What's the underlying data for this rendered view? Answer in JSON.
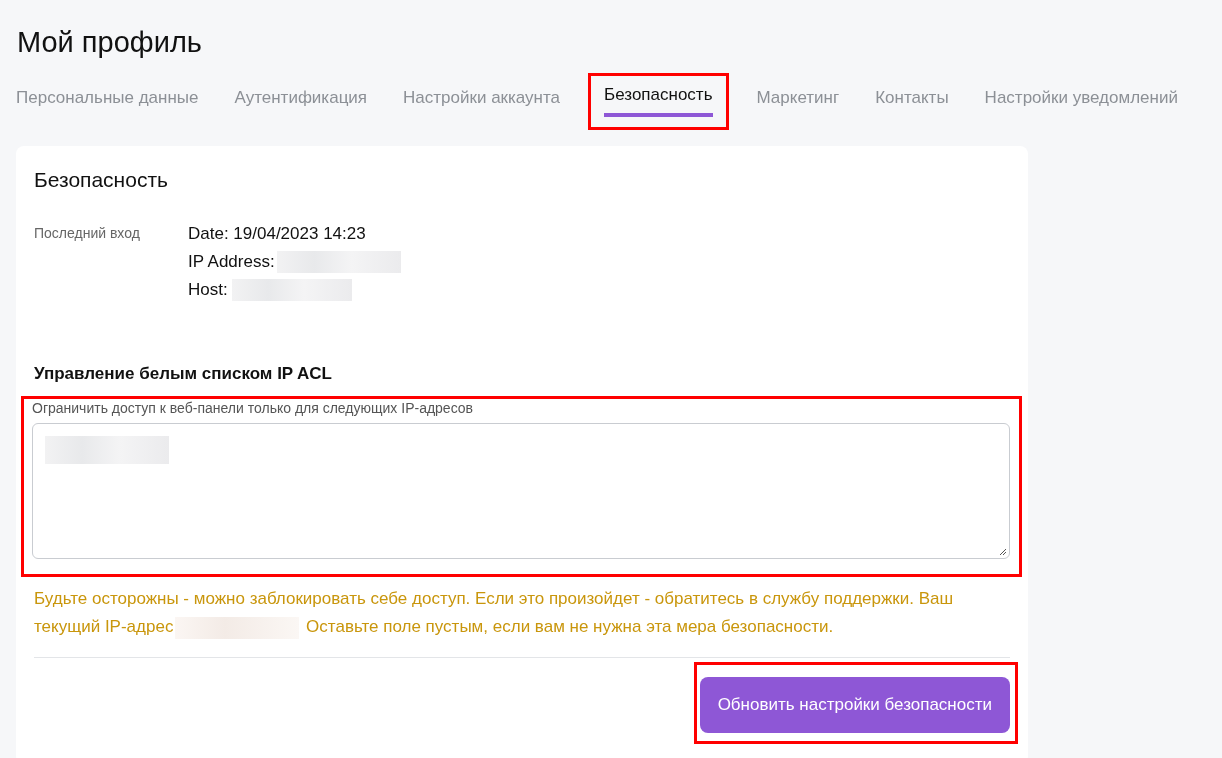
{
  "page": {
    "title": "Мой профиль"
  },
  "tabs": [
    {
      "label": "Персональные данные",
      "selected": false,
      "highlighted": false
    },
    {
      "label": "Аутентификация",
      "selected": false,
      "highlighted": false
    },
    {
      "label": "Настройки аккаунта",
      "selected": false,
      "highlighted": false
    },
    {
      "label": "Безопасность",
      "selected": true,
      "highlighted": true
    },
    {
      "label": "Маркетинг",
      "selected": false,
      "highlighted": false
    },
    {
      "label": "Контакты",
      "selected": false,
      "highlighted": false
    },
    {
      "label": "Настройки уведомлений",
      "selected": false,
      "highlighted": false
    }
  ],
  "card": {
    "title": "Безопасность",
    "last_login": {
      "label": "Последний вход",
      "lines": [
        {
          "text": "Date: 19/04/2023 14:23",
          "redacted": false
        },
        {
          "text": "IP Address:",
          "redacted": true
        },
        {
          "text": "Host:",
          "redacted": true
        }
      ]
    },
    "whitelist": {
      "title": "Управление белым списком IP ACL",
      "field_label": "Ограничить доступ к веб-панели только для следующих IP-адресов",
      "value_redacted": true,
      "highlighted": true
    },
    "warning": {
      "before": "Будьте осторожны - можно заблокировать себе доступ. Если это произойдет - обратитесь в службу поддержки. Ваш текущий IP-адрес",
      "redacted": true,
      "after": "Оставьте поле пустым, если вам не нужна эта мера безопасности."
    },
    "button": {
      "label": "Обновить настройки безопасности",
      "highlighted": true
    }
  }
}
